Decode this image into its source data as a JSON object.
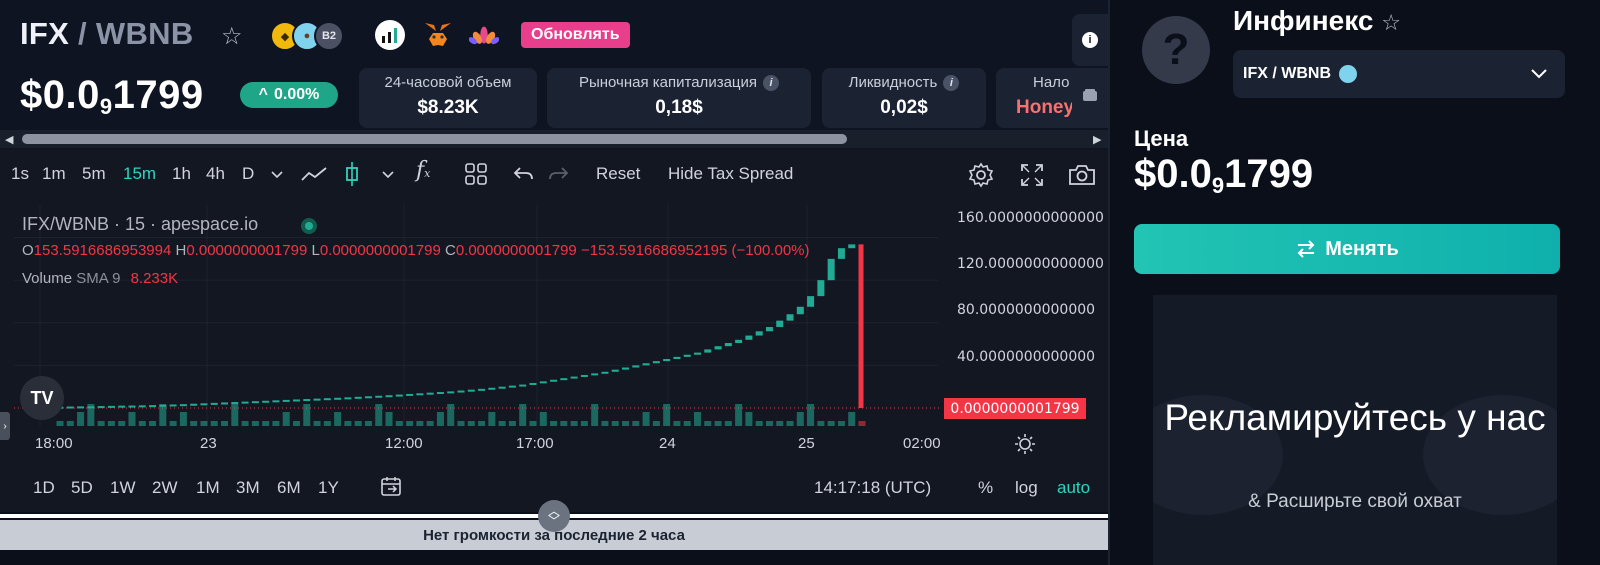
{
  "header": {
    "base": "IFX",
    "quote": "WBNB",
    "badge_b2": "B2",
    "update_label": "Обновлять",
    "price_prefix": "$0.0",
    "price_sub": "9",
    "price_suffix": "1799",
    "change": "0.00%",
    "stats": [
      {
        "label": "24-часовой объем",
        "value": "$8.23K"
      },
      {
        "label": "Рыночная капитализация",
        "value": "0,18$"
      },
      {
        "label": "Ликвидность",
        "value": "0,02$"
      },
      {
        "label": "Нало",
        "value": "Honey"
      }
    ],
    "side_info_icon": "i"
  },
  "toolbar": {
    "intervals": [
      "1s",
      "1m",
      "5m",
      "15m",
      "1h",
      "4h",
      "D"
    ],
    "active_interval": "15m",
    "reset_label": "Reset",
    "hide_tax_label": "Hide Tax Spread"
  },
  "legend": {
    "title": "IFX/WBNB · 15 · apespace.io",
    "o_label": "O",
    "o_value": "153.5916686953994",
    "h_label": "H",
    "h_value": "0.0000000001799",
    "l_label": "L",
    "l_value": "0.0000000001799",
    "c_label": "C",
    "c_value": "0.0000000001799",
    "change": "−153.5916686952195 (−100.00%)",
    "volume_label": "Volume",
    "volume_sma": "SMA 9",
    "volume_value": "8.233K"
  },
  "chart_data": {
    "type": "candlestick",
    "y_ticks": [
      "160.0000000000000",
      "120.0000000000000",
      "80.0000000000000",
      "40.0000000000000"
    ],
    "ylim": [
      0,
      180
    ],
    "last_price_label": "0.0000000001799",
    "x_ticks": [
      "18:00",
      "23",
      "12:00",
      "17:00",
      "24",
      "25",
      "02:00"
    ],
    "closes": [
      1.2,
      1.4,
      1.5,
      1.6,
      1.8,
      2.0,
      2.2,
      2.3,
      2.5,
      2.7,
      3.0,
      3.3,
      3.6,
      4.0,
      4.4,
      4.8,
      5.2,
      5.6,
      6.0,
      6.4,
      6.8,
      7.2,
      7.6,
      8.0,
      8.4,
      8.8,
      9.2,
      9.6,
      10.0,
      10.5,
      11.0,
      11.5,
      12.0,
      12.6,
      13.2,
      13.8,
      14.4,
      15.0,
      15.6,
      16.4,
      17.2,
      18.0,
      19.0,
      20.0,
      21.0,
      22.0,
      23.5,
      25.0,
      26.5,
      28.0,
      29.5,
      31.0,
      32.5,
      34.0,
      36.0,
      38.0,
      40.0,
      42.0,
      44.0,
      46.0,
      48.0,
      50.0,
      52.0,
      55.0,
      58.0,
      61.0,
      64.0,
      68.0,
      72.0,
      76.0,
      82.0,
      88.0,
      95.0,
      105.0,
      120.0,
      140.0,
      150.0,
      153.59,
      1.799e-10
    ]
  },
  "range": {
    "items": [
      "1D",
      "5D",
      "1W",
      "2W",
      "1M",
      "3M",
      "6M",
      "1Y"
    ],
    "time": "14:17:18 (UTC)",
    "pct": "%",
    "log": "log",
    "auto": "auto"
  },
  "bottom": {
    "message": "Нет громкости за последние 2 часа"
  },
  "right": {
    "token_name": "Инфинекс",
    "pair": "IFX / WBNB",
    "price_label": "Цена",
    "price_prefix": "$0.0",
    "price_sub": "9",
    "price_suffix": "1799",
    "swap_label": "Менять",
    "ad_title": "Рекламируйтесь у нас",
    "ad_sub": "& Расширьте свой охват",
    "avatar_glyph": "?"
  },
  "colors": {
    "accent": "#2dd4bf",
    "up": "#22ab94",
    "down": "#f23645",
    "update_btn": "#e83e8c"
  }
}
